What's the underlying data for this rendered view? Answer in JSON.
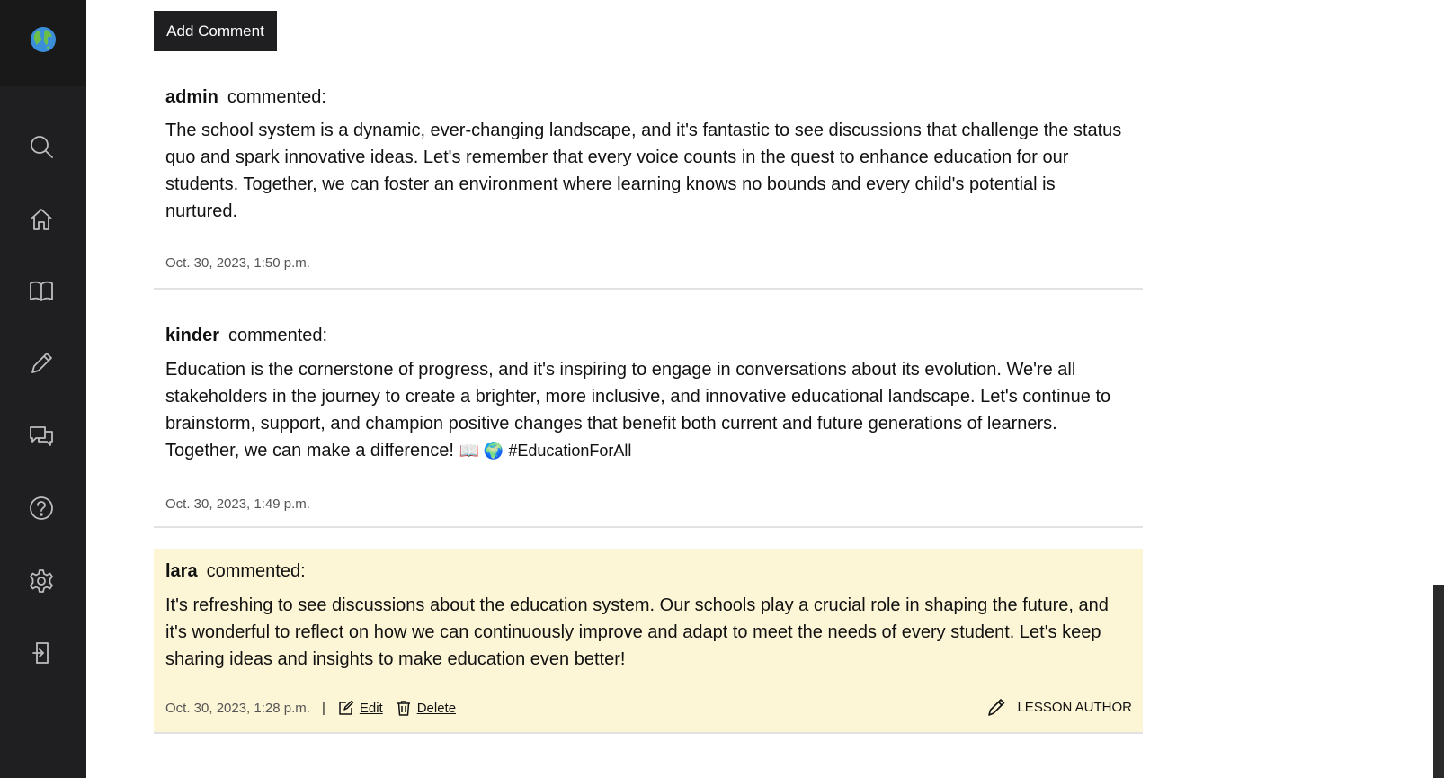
{
  "sidebar": {
    "logo": "globe-logo",
    "icons": [
      "search-icon",
      "home-icon",
      "book-icon",
      "pencil-icon",
      "chat-icon",
      "help-icon",
      "gear-icon",
      "logout-icon"
    ]
  },
  "add_button_label": "Add Comment",
  "comments": [
    {
      "author": "admin",
      "verb": "commented:",
      "body": "The school system is a dynamic, ever-changing landscape, and it's fantastic to see discussions that challenge the status quo and spark innovative ideas. Let's remember that every voice counts in the quest to enhance education for our students. Together, we can foster an environment where learning knows no bounds and every child's potential is nurtured.",
      "date": "Oct. 30, 2023, 1:50 p.m."
    },
    {
      "author": "kinder",
      "verb": "commented:",
      "body": "Education is the cornerstone of progress, and it's inspiring to engage in conversations about its evolution. We're all stakeholders in the journey to create a brighter, more inclusive, and innovative educational landscape. Let's continue to brainstorm, support, and champion positive changes that benefit both current and future generations of learners. Together, we can make a difference!",
      "body_tail": "📖 🌍 #EducationForAll",
      "date": "Oct. 30, 2023, 1:49 p.m."
    },
    {
      "author": "lara",
      "verb": "commented:",
      "body": "It's refreshing to see discussions about the education system. Our schools play a crucial role in shaping the future, and it's wonderful to reflect on how we can continuously improve and adapt to meet the needs of every student. Let's keep sharing ideas and insights to make education even better!",
      "date": "Oct. 30, 2023, 1:28 p.m.",
      "separator": "|",
      "edit_label": "Edit",
      "delete_label": "Delete",
      "badge_label": "LESSON AUTHOR",
      "highlight_color": "#fdf6d6"
    }
  ],
  "colors": {
    "sidebar_bg": "#1f1f22",
    "button_bg": "#1f1f22",
    "divider": "#e2e2e2"
  }
}
